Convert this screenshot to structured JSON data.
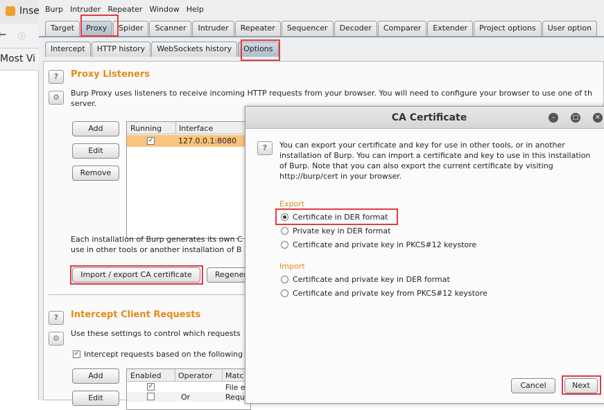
{
  "browser": {
    "tab_title": "Inse",
    "bookmarks": "Most Vi"
  },
  "menu": [
    "Burp",
    "Intruder",
    "Repeater",
    "Window",
    "Help"
  ],
  "tabs": [
    "Target",
    "Proxy",
    "Spider",
    "Scanner",
    "Intruder",
    "Repeater",
    "Sequencer",
    "Decoder",
    "Comparer",
    "Extender",
    "Project options",
    "User option"
  ],
  "subtabs": [
    "Intercept",
    "HTTP history",
    "WebSockets history",
    "Options"
  ],
  "listeners": {
    "title": "Proxy Listeners",
    "desc1": "Burp Proxy uses listeners to receive incoming HTTP requests from your browser. You will need to configure your browser to use one of th",
    "desc2": "server.",
    "buttons": [
      "Add",
      "Edit",
      "Remove"
    ],
    "columns": [
      "Running",
      "Interface"
    ],
    "rows": [
      {
        "running": true,
        "interface": "127.0.0.1:8080"
      }
    ],
    "ca_text1": "Each installation of Burp generates its own C",
    "ca_text2": "use in other tools or another installation of B",
    "import_btn": "Import / export CA certificate",
    "regen_btn": "Regener"
  },
  "intercept": {
    "title": "Intercept Client Requests",
    "desc": "Use these settings to control which requests",
    "checkbox": "Intercept requests based on the following",
    "buttons": [
      "Add",
      "Edit"
    ],
    "columns": [
      "Enabled",
      "Operator",
      "Matc"
    ],
    "rows": [
      {
        "enabled": true,
        "operator": "",
        "match": "File e"
      },
      {
        "enabled": false,
        "operator": "Or",
        "match": "Requ"
      }
    ]
  },
  "dialog": {
    "title": "CA Certificate",
    "desc": [
      "You can export your certificate and key for use in other tools, or in another",
      "installation of Burp. You can import a certificate and key to use in this installation",
      "of Burp. Note that you can also export the current certificate by visiting",
      "http://burp/cert in your browser."
    ],
    "export_label": "Export",
    "export_options": [
      "Certificate in DER format",
      "Private key in DER format",
      "Certificate and private key in PKCS#12 keystore"
    ],
    "import_label": "Import",
    "import_options": [
      "Certificate and private key in DER format",
      "Certificate and private key from PKCS#12 keystore"
    ],
    "cancel": "Cancel",
    "next": "Next"
  }
}
